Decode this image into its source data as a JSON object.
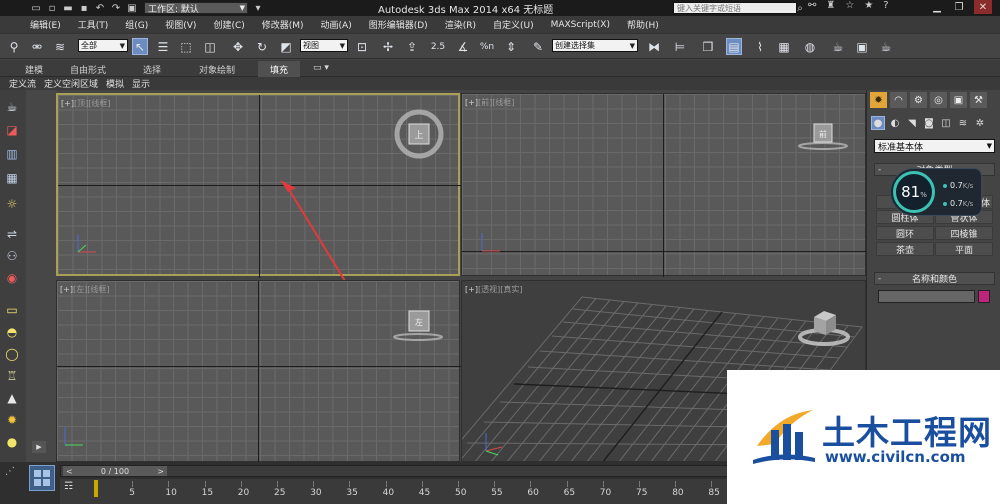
{
  "titlebar": {
    "workspace_label": "工作区: 默认",
    "app_title": "Autodesk 3ds Max  2014 x64     无标题",
    "search_placeholder": "键入关键字或短语"
  },
  "menu": [
    "编辑(E)",
    "工具(T)",
    "组(G)",
    "视图(V)",
    "创建(C)",
    "修改器(M)",
    "动画(A)",
    "图形编辑器(D)",
    "渲染(R)",
    "自定义(U)",
    "MAXScript(X)",
    "帮助(H)"
  ],
  "toolbar": {
    "filter_value": "全部",
    "refcoord_value": "视图",
    "snap_angle_label": "2.5",
    "snap_percent_label": "%n",
    "named_selection_value": "创建选择集"
  },
  "ribbon": {
    "tabs": [
      "建模",
      "自由形式",
      "选择",
      "对象绘制",
      "填充"
    ],
    "active_tab": "填充"
  },
  "submenu": [
    "定义流",
    "定义空闲区域",
    "模拟",
    "显示"
  ],
  "viewports": {
    "top": {
      "plus": "[+]",
      "view": "[顶]",
      "shading": "[线框]"
    },
    "front": {
      "plus": "[+]",
      "view": "[前]",
      "shading": "[线框]"
    },
    "left": {
      "plus": "[+]",
      "view": "[左]",
      "shading": "[线框]"
    },
    "perspective": {
      "plus": "[+]",
      "view": "[透视]",
      "shading": "[真实]"
    }
  },
  "viewcube_faces": {
    "top": "上",
    "front": "前",
    "left": "左"
  },
  "command_panel": {
    "category_value": "标准基本体",
    "object_type_title": "对象类型",
    "name_color_title": "名称和颜色",
    "buttons": [
      "几何球体",
      "圆柱体",
      "管状体",
      "圆环",
      "四棱锥",
      "茶壶",
      "平面"
    ],
    "partial_labels": [
      "身"
    ],
    "swatch_color": "#c0237a"
  },
  "net_monitor": {
    "percent": "81",
    "percent_unit": "%",
    "upload": "0.7",
    "download": "0.7",
    "unit": "K/s"
  },
  "timeline": {
    "slider_value": "0 / 100",
    "ticks": [
      "0",
      "5",
      "10",
      "15",
      "20",
      "25",
      "30",
      "35",
      "40",
      "45",
      "50",
      "55",
      "60",
      "65",
      "70",
      "75",
      "80",
      "85"
    ]
  },
  "watermark": {
    "chinese": "土木工程网",
    "url": "www.civilcn.com"
  }
}
